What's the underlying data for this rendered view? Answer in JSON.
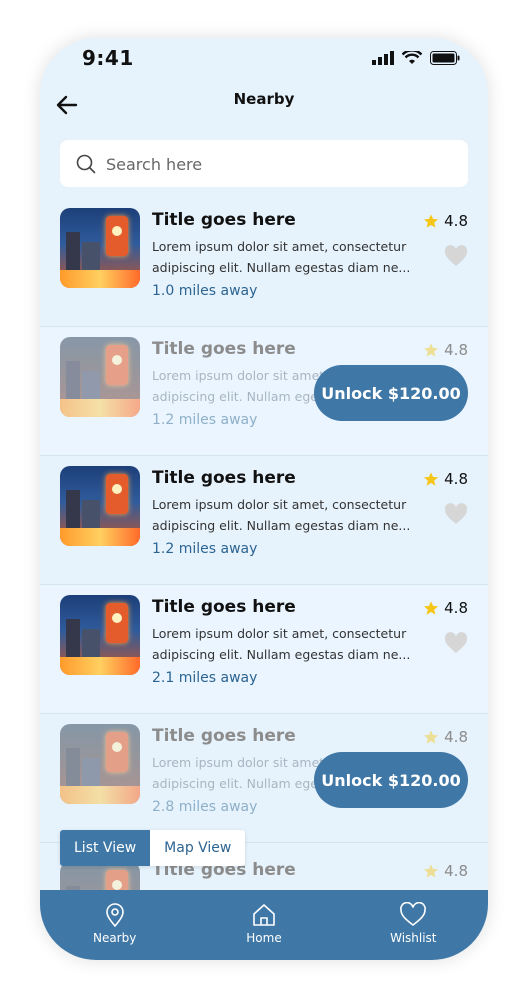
{
  "status_bar": {
    "time": "9:41"
  },
  "header": {
    "title": "Nearby"
  },
  "search": {
    "placeholder": "Search here"
  },
  "items": [
    {
      "title": "Title goes here",
      "desc_line1": "Lorem ipsum dolor sit amet, consectetur",
      "desc_line2": "adipiscing elit. Nullam egestas diam ne...",
      "distance": "1.0 miles away",
      "rating": "4.8"
    },
    {
      "title": "Title goes here",
      "desc_line1": "Lorem ipsum dolor sit amet, consectetur",
      "desc_line2": "adipiscing elit. Nullam egestas diam ne...",
      "distance": "1.2 miles away",
      "rating": "4.8",
      "unlock": "Unlock $120.00"
    },
    {
      "title": "Title goes here",
      "desc_line1": "Lorem ipsum dolor sit amet, consectetur",
      "desc_line2": "adipiscing elit. Nullam egestas diam ne...",
      "distance": "1.2 miles away",
      "rating": "4.8"
    },
    {
      "title": "Title goes here",
      "desc_line1": "Lorem ipsum dolor sit amet, consectetur",
      "desc_line2": "adipiscing elit. Nullam egestas diam ne...",
      "distance": "2.1 miles away",
      "rating": "4.8"
    },
    {
      "title": "Title goes here",
      "desc_line1": "Lorem ipsum dolor sit amet, consectetur",
      "desc_line2": "adipiscing elit. Nullam egestas diam ne...",
      "distance": "2.8 miles away",
      "rating": "4.8",
      "unlock": "Unlock $120.00"
    },
    {
      "title": "Title goes here",
      "rating": "4.8"
    }
  ],
  "view_toggle": {
    "list": "List View",
    "map": "Map View"
  },
  "bottom_nav": {
    "nearby": "Nearby",
    "home": "Home",
    "wishlist": "Wishlist"
  },
  "colors": {
    "accent": "#3f77a6",
    "star": "#f5c518",
    "background": "#e6f3fd"
  }
}
